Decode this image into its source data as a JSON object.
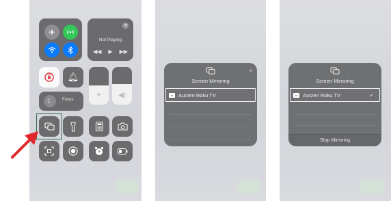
{
  "panel1": {
    "now_playing": "Not Playing",
    "focus_label": "Focus",
    "media_controls": [
      "◀◀",
      "▶",
      "▶▶"
    ]
  },
  "panel2": {
    "title": "Screen Mirroring",
    "device": "Aurzen Roku TV"
  },
  "panel3": {
    "title": "Screen Mirroring",
    "device": "Aurzen Roku TV",
    "checkmark": "✓",
    "stop_label": "Stop Mirroring"
  },
  "colors": {
    "tile": "#6b6b6d",
    "airplane_circle": "#8e8e93",
    "cellular_circle": "#34c759",
    "wifi_circle": "#0a7aff",
    "bluetooth_circle": "#0a7aff",
    "arrow": "#e0262b",
    "highlight_border": "#2e6b4d"
  }
}
